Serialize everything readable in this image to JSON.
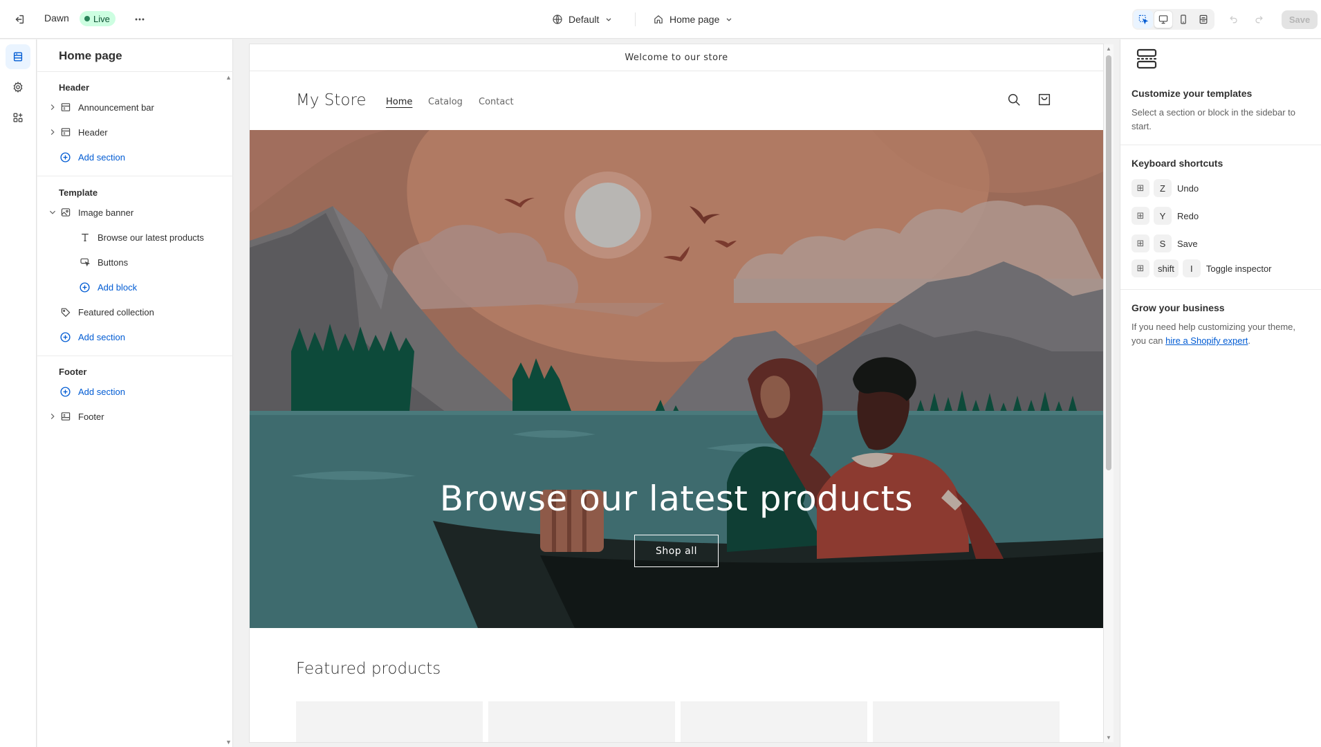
{
  "topbar": {
    "theme_name": "Dawn",
    "status": "Live",
    "market": "Default",
    "page": "Home page",
    "save_label": "Save"
  },
  "sidebar": {
    "title": "Home page",
    "header_group": {
      "label": "Header",
      "items": [
        "Announcement bar",
        "Header"
      ],
      "add_label": "Add section"
    },
    "template_group": {
      "label": "Template",
      "section": "Image banner",
      "blocks": [
        "Browse our latest products",
        "Buttons"
      ],
      "add_block_label": "Add block",
      "section2": "Featured collection",
      "add_label": "Add section"
    },
    "footer_group": {
      "label": "Footer",
      "add_label": "Add section",
      "item": "Footer"
    }
  },
  "preview": {
    "announcement": "Welcome to our store",
    "logo": "My Store",
    "nav": [
      "Home",
      "Catalog",
      "Contact"
    ],
    "banner_heading": "Browse our latest products",
    "banner_button": "Shop all",
    "featured_title": "Featured products"
  },
  "right_panel": {
    "title": "Customize your templates",
    "description": "Select a section or block in the sidebar to start.",
    "shortcuts_title": "Keyboard shortcuts",
    "shortcuts": [
      {
        "keys": [
          "Z"
        ],
        "label": "Undo"
      },
      {
        "keys": [
          "Y"
        ],
        "label": "Redo"
      },
      {
        "keys": [
          "S"
        ],
        "label": "Save"
      },
      {
        "keys": [
          "shift",
          "I"
        ],
        "label": "Toggle inspector"
      }
    ],
    "grow_title": "Grow your business",
    "grow_text": "If you need help customizing your theme, you can",
    "grow_link": "hire a Shopify expert",
    "grow_end": "."
  },
  "colors": {
    "accent": "#005bd3",
    "live_badge_bg": "#cdfee1",
    "live_badge_text": "#0c5132"
  }
}
